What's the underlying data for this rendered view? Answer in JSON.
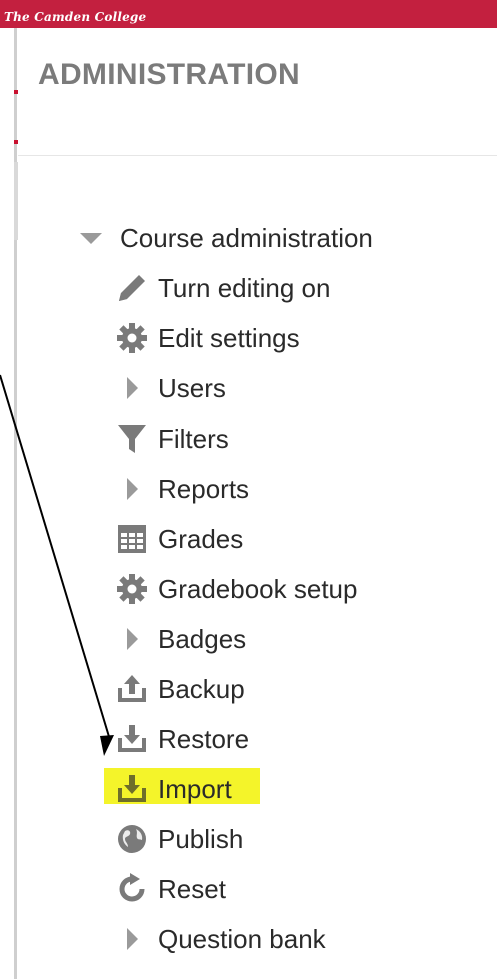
{
  "header": {
    "college_name": "The Camden College",
    "brand_color": "#c3203f"
  },
  "panel": {
    "title": "ADMINISTRATION"
  },
  "menu": {
    "root": {
      "label": "Course administration",
      "icon": "caret-down-icon"
    },
    "items": [
      {
        "label": "Turn editing on",
        "icon": "pencil-icon"
      },
      {
        "label": "Edit settings",
        "icon": "gear-icon"
      },
      {
        "label": "Users",
        "icon": "caret-right-icon"
      },
      {
        "label": "Filters",
        "icon": "filter-icon"
      },
      {
        "label": "Reports",
        "icon": "caret-right-icon"
      },
      {
        "label": "Grades",
        "icon": "table-icon"
      },
      {
        "label": "Gradebook setup",
        "icon": "gear-icon"
      },
      {
        "label": "Badges",
        "icon": "caret-right-icon"
      },
      {
        "label": "Backup",
        "icon": "upload-icon"
      },
      {
        "label": "Restore",
        "icon": "download-icon"
      },
      {
        "label": "Import",
        "icon": "download-icon",
        "highlighted": true
      },
      {
        "label": "Publish",
        "icon": "globe-icon"
      },
      {
        "label": "Reset",
        "icon": "refresh-icon"
      },
      {
        "label": "Question bank",
        "icon": "caret-right-icon"
      }
    ]
  },
  "annotation": {
    "arrow_color": "#000000",
    "highlight_color": "#f4f42a"
  }
}
